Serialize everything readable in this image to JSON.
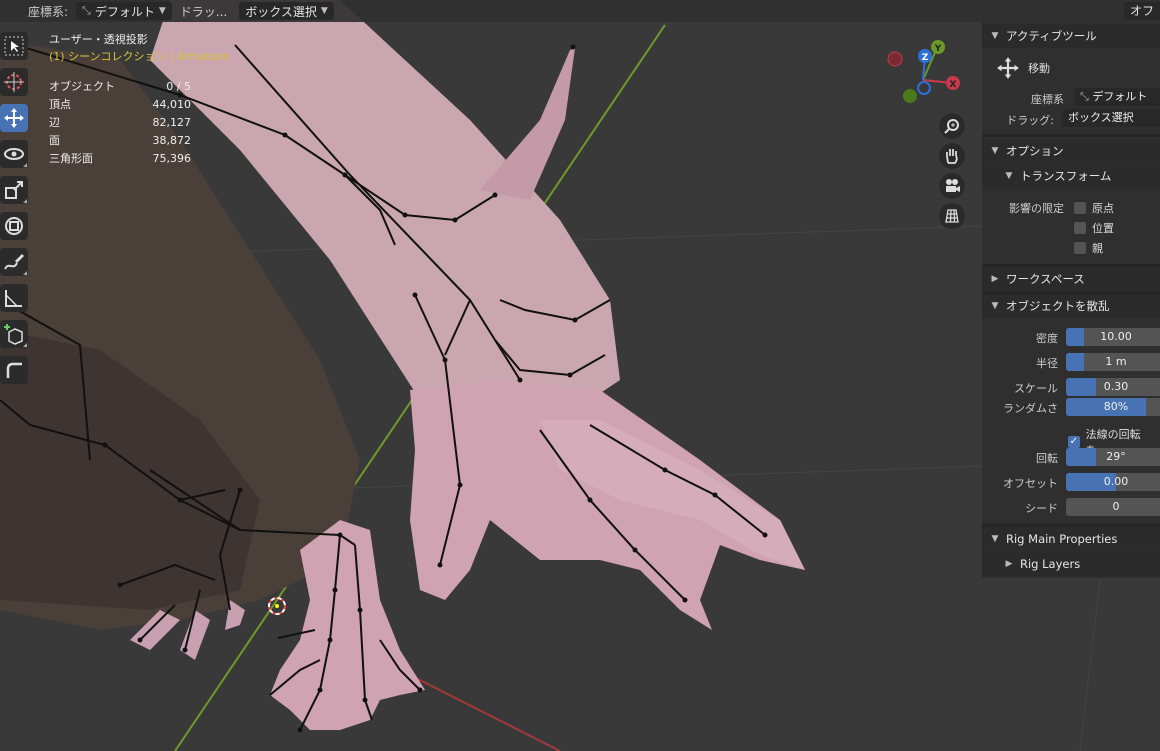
{
  "header": {
    "orientation_label": "座標系:",
    "orientation_value": "デフォルト",
    "drag_label": "ドラッ...",
    "drag_value": "ボックス選択",
    "right_cut": "オフ"
  },
  "toolbar": {
    "tools": [
      {
        "name": "select-box-tool",
        "icon": "cursor-arrow-icon"
      },
      {
        "name": "cursor-tool",
        "icon": "3d-cursor-icon"
      },
      {
        "name": "move-tool",
        "icon": "move-arrows-icon",
        "active": true
      },
      {
        "name": "rotate-tool",
        "icon": "rotate-icon"
      },
      {
        "name": "scale-tool",
        "icon": "scale-icon"
      },
      {
        "name": "transform-tool",
        "icon": "transform-icon"
      },
      {
        "name": "annotate-tool",
        "icon": "annotate-pen-icon"
      },
      {
        "name": "measure-tool",
        "icon": "ruler-icon"
      },
      {
        "name": "add-cube-tool",
        "icon": "add-cube-icon"
      },
      {
        "name": "extra-tool",
        "icon": "corner-icon"
      }
    ]
  },
  "overlay": {
    "view_name": "ユーザー・透視投影",
    "collection": "(1) シーンコレクション | Armature",
    "stats": [
      {
        "k": "オブジェクト",
        "v": "0 / 5"
      },
      {
        "k": "頂点",
        "v": "44,010"
      },
      {
        "k": "辺",
        "v": "82,127"
      },
      {
        "k": "面",
        "v": "38,872"
      },
      {
        "k": "三角形面",
        "v": "75,396"
      }
    ]
  },
  "gizmo": {
    "x_label": "X",
    "y_label": "Y",
    "z_label": "Z",
    "x_color": "#c83a4a",
    "y_color": "#6a9a2a",
    "z_color": "#2f6fd8"
  },
  "nav_buttons": [
    "zoom-icon",
    "hand-pan-icon",
    "camera-icon",
    "grid-ortho-icon"
  ],
  "sidebar": {
    "active_tool": {
      "title": "アクティブツール",
      "tool_name": "移動",
      "orientation_label": "座標系",
      "orientation_value": "デフォルト",
      "drag_label": "ドラッグ:",
      "drag_value": "ボックス選択"
    },
    "options": {
      "title": "オプション",
      "transform_title": "トランスフォーム",
      "affect_only_label": "影響の限定",
      "checks": [
        {
          "label": "原点",
          "checked": false
        },
        {
          "label": "位置",
          "checked": false
        },
        {
          "label": "親",
          "checked": false
        }
      ]
    },
    "workspace_title": "ワークスペース",
    "scatter": {
      "title": "オブジェクトを散乱",
      "fields": [
        {
          "label": "密度",
          "value": "10.00",
          "fill": 0.18
        },
        {
          "label": "半径",
          "value": "1 m",
          "fill": 0.18
        },
        {
          "label": "スケール",
          "value": "0.30",
          "fill": 0.3
        },
        {
          "label": "ランダムさ",
          "value": "80%",
          "fill": 0.8
        },
        {
          "label": "回転",
          "value": "29°",
          "fill": 0.3
        },
        {
          "label": "オフセット",
          "value": "0.00",
          "fill": 0.5
        },
        {
          "label": "シード",
          "value": "0",
          "fill": 0
        }
      ],
      "normal_rotation_label": "法線の回転を...",
      "normal_rotation_checked": true
    },
    "rig_main": "Rig Main Properties",
    "rig_layers": "Rig Layers"
  }
}
